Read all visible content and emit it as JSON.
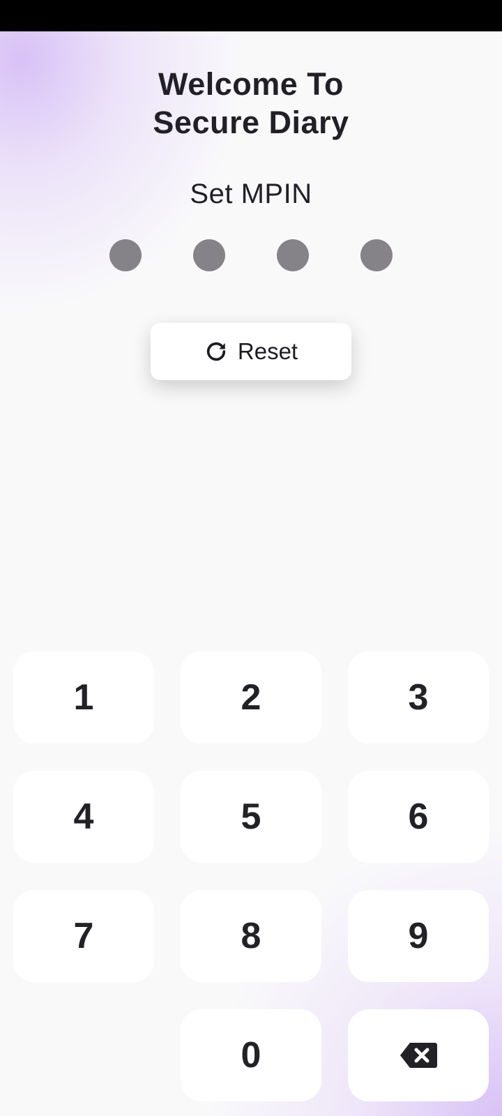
{
  "header": {
    "title_line1": "Welcome To",
    "title_line2": "Secure Diary",
    "subtitle": "Set MPIN"
  },
  "pin": {
    "length": 4,
    "entered": 0
  },
  "reset": {
    "label": "Reset",
    "icon": "refresh-icon"
  },
  "keypad": {
    "keys": [
      "1",
      "2",
      "3",
      "4",
      "5",
      "6",
      "7",
      "8",
      "9",
      "0"
    ],
    "backspace_icon": "backspace-icon"
  },
  "colors": {
    "accent": "#d6bef6",
    "text": "#221f27",
    "pin_dot": "#858288",
    "key_bg": "#ffffff"
  }
}
